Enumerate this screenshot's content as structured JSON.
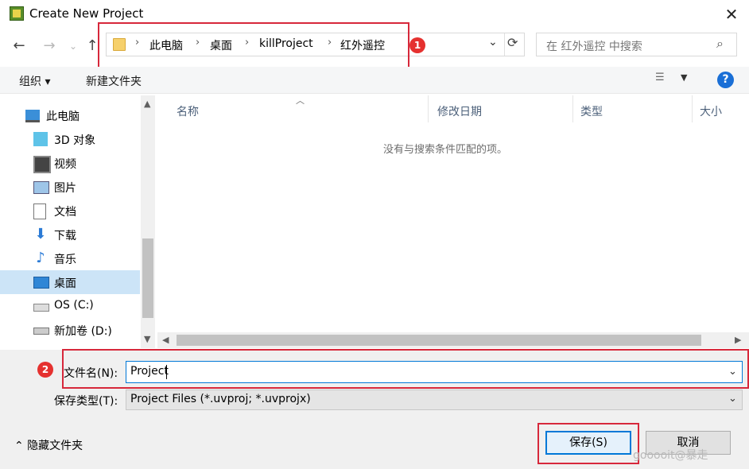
{
  "window": {
    "title": "Create New Project",
    "close": "✕"
  },
  "nav": {
    "back": "←",
    "forward": "→",
    "recent": "⌄",
    "up": "↑",
    "breadcrumb": [
      "此电脑",
      "桌面",
      "killProject",
      "红外遥控"
    ],
    "separator": "›",
    "dropdown": "⌄",
    "refresh": "⟳",
    "search_placeholder": "在 红外遥控 中搜索"
  },
  "toolbar": {
    "organize": "组织 ▾",
    "new_folder": "新建文件夹",
    "help": "?"
  },
  "sidebar": {
    "items": [
      {
        "label": "此电脑",
        "icon": "computer-icon"
      },
      {
        "label": "3D 对象",
        "icon": "cube-3d-icon"
      },
      {
        "label": "视频",
        "icon": "video-icon"
      },
      {
        "label": "图片",
        "icon": "picture-icon"
      },
      {
        "label": "文档",
        "icon": "document-icon"
      },
      {
        "label": "下载",
        "icon": "download-icon"
      },
      {
        "label": "音乐",
        "icon": "music-icon"
      },
      {
        "label": "桌面",
        "icon": "desktop-icon"
      },
      {
        "label": "OS (C:)",
        "icon": "drive-c-icon"
      },
      {
        "label": "新加卷 (D:)",
        "icon": "drive-d-icon"
      }
    ],
    "selected": "桌面"
  },
  "file_list": {
    "columns": [
      "名称",
      "修改日期",
      "类型",
      "大小"
    ],
    "empty_message": "没有与搜索条件匹配的项。"
  },
  "form": {
    "filename_label": "文件名(N):",
    "filename_value": "Project",
    "filetype_label": "保存类型(T):",
    "filetype_value": "Project Files (*.uvproj; *.uvprojx)"
  },
  "footer": {
    "hide_folders": "⌃ 隐藏文件夹",
    "save": "保存(S)",
    "cancel": "取消"
  },
  "annotations": {
    "badge1": "1",
    "badge2": "2",
    "color": "#d7283b"
  },
  "watermark": "gooooit@暴走"
}
